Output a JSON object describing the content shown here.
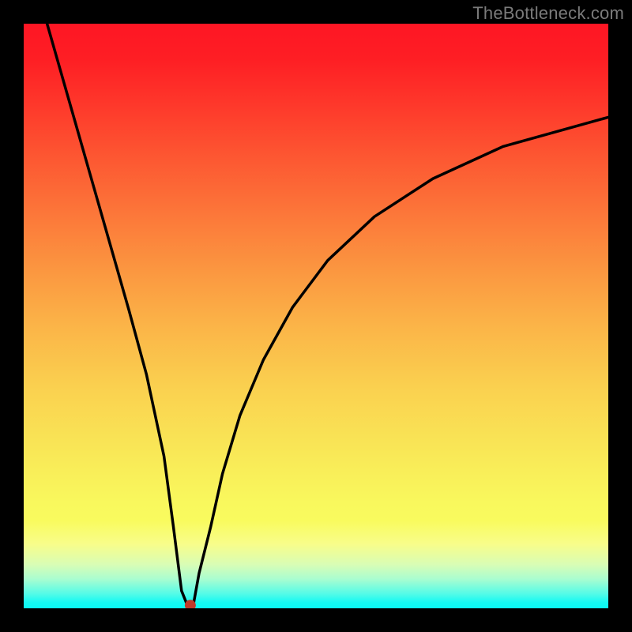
{
  "watermark": "TheBottleneck.com",
  "chart_data": {
    "type": "line",
    "title": "",
    "xlabel": "",
    "ylabel": "",
    "x": [
      4,
      6,
      9,
      12,
      15,
      18,
      21,
      24,
      25.6,
      27,
      28,
      29,
      30,
      32,
      34,
      37,
      41,
      46,
      52,
      60,
      70,
      82,
      100
    ],
    "y": [
      100,
      93,
      82.5,
      72,
      61.5,
      51,
      40,
      26,
      14,
      3,
      0.5,
      0.5,
      6,
      14,
      23,
      33,
      42.5,
      51.5,
      59.5,
      67,
      73.5,
      79,
      84
    ],
    "min_marker": {
      "x": 28.5,
      "y": 0.5
    },
    "ylim": [
      0,
      100
    ],
    "xlim": [
      0,
      100
    ],
    "grid": false,
    "legend": false
  },
  "colors": {
    "frame": "#000000",
    "watermark": "#7a7a7a",
    "curve": "#000000",
    "marker": "#c0392b",
    "gradient_top": "#fe1624",
    "gradient_bottom": "#0afaf5"
  }
}
